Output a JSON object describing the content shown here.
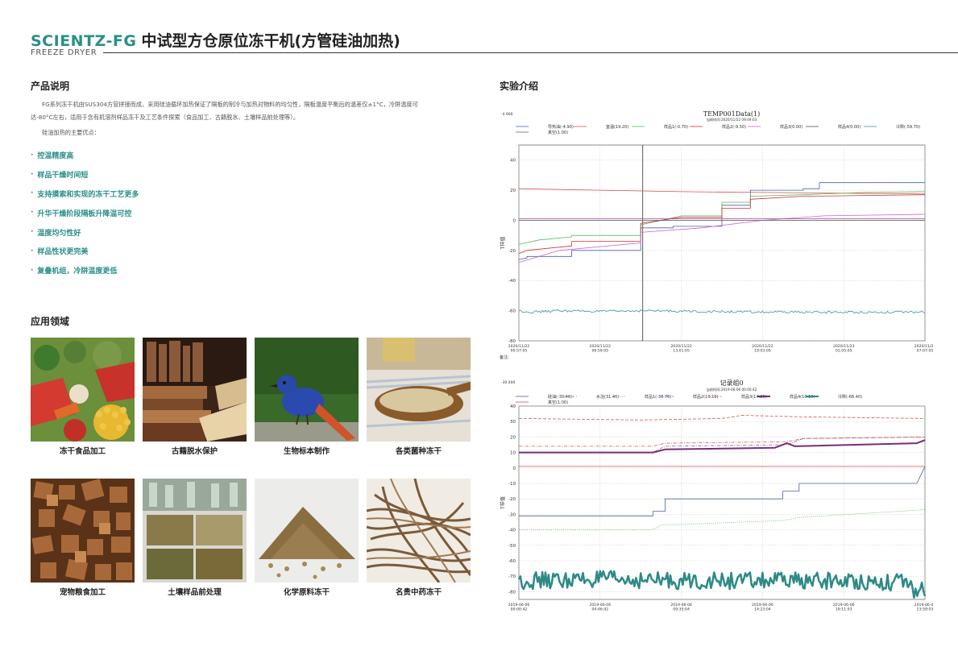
{
  "header": {
    "brand": "SCIENTZ-FG",
    "title": "中试型方仓原位冻干机(方管硅油加热)",
    "subtitle": "FREEZE DRYER"
  },
  "product": {
    "heading": "产品说明",
    "line1": "FG系列冻干机由SUS304方管拼接而成，采用硅油循环加热保证了隔板的制冷与加热对物料的均匀性，隔板温度平衡后的温差仅±1°C，冷阱温度可",
    "line2": "达-80°C左右，适用于含有机溶剂样品冻干及工艺条件探索（食品加工、古籍脱水、土壤样品前处理等）。",
    "advantages_intro": "硅油加热的主要优点：",
    "features": [
      "控温精度高",
      "样品干燥时间短",
      "支持摸索和实现的冻干工艺更多",
      "升华干燥阶段隔板升降温可控",
      "温度均匀性好",
      "样品性状更完美",
      "复叠机组，冷阱温度更低"
    ]
  },
  "applications": {
    "heading": "应用领域",
    "items": [
      "冻干食品加工",
      "古籍脱水保护",
      "生物标本制作",
      "各类菌种冻干",
      "宠物粮食加工",
      "土壤样品前处理",
      "化学原料冻干",
      "名贵中药冻干"
    ]
  },
  "experiment": {
    "heading": "实验介绍"
  },
  "chart_data": [
    {
      "type": "line",
      "title": "TEMP001Data(1)",
      "subtitle": "当前时间:2020/11/22  09:49:03",
      "corner_label": "-4.900",
      "ylabel": "T样值",
      "footer_label": "备注:",
      "ylim": [
        -80,
        50
      ],
      "yticks": [
        -80,
        -60,
        -40,
        -20,
        0,
        20,
        40
      ],
      "x_ticks": [
        "2020/11/22\n00:57:05",
        "2020/11/22\n06:59:05",
        "2020/11/22\n13:01:05",
        "2020/11/22\n19:03:05",
        "2020/11/23\n01:05:05",
        "2020/11/23\n07:07:05"
      ],
      "grid": true,
      "cursor_x": 0.305,
      "series": [
        {
          "name": "导热油(-4.90)",
          "color": "#4a5fb0",
          "style": "solid",
          "width": 0.8,
          "x": [
            0,
            0.02,
            0.02,
            0.13,
            0.13,
            0.3,
            0.3,
            0.38,
            0.38,
            0.5,
            0.5,
            0.57,
            0.57,
            0.7,
            0.7,
            0.74,
            0.74,
            1
          ],
          "y": [
            -26,
            -25,
            -24,
            -24,
            -20,
            -20,
            -5,
            -5,
            -4,
            -4,
            10,
            10,
            20,
            20,
            21,
            21,
            25,
            25
          ]
        },
        {
          "name": "室温(19.20)",
          "color": "#d9534f",
          "style": "solid",
          "width": 0.8,
          "x": [
            0,
            0.2,
            0.4,
            0.6,
            0.8,
            1
          ],
          "y": [
            21,
            20,
            19,
            18.5,
            18,
            17.5
          ]
        },
        {
          "name": "样品1(-0.70)",
          "color": "#5cb85c",
          "style": "solid",
          "width": 0.8,
          "x": [
            0,
            0.05,
            0.13,
            0.13,
            0.3,
            0.3,
            0.4,
            0.5,
            0.5,
            0.57,
            0.57,
            0.7,
            0.85,
            1
          ],
          "y": [
            -16,
            -13,
            -11,
            -10,
            -10,
            -3,
            3,
            3,
            12,
            12,
            16,
            17,
            18.5,
            19
          ]
        },
        {
          "name": "样品2(-9.50)",
          "color": "#cc3333",
          "style": "solid",
          "width": 0.8,
          "x": [
            0,
            0.02,
            0.13,
            0.13,
            0.3,
            0.3,
            0.4,
            0.5,
            0.5,
            0.57,
            0.57,
            0.7,
            1
          ],
          "y": [
            -22,
            -20,
            -17,
            -14,
            -14,
            -2,
            2,
            2,
            8,
            8,
            14,
            16,
            17
          ]
        },
        {
          "name": "样品3(0.00)",
          "color": "#cc66cc",
          "style": "solid",
          "width": 0.8,
          "x": [
            0,
            0.1,
            0.3,
            0.3,
            0.45,
            0.6,
            0.75,
            1
          ],
          "y": [
            -28,
            -20,
            -15,
            -8,
            -5,
            0,
            3,
            4
          ]
        },
        {
          "name": "样品4(0.00)",
          "color": "#555555",
          "style": "solid",
          "width": 0.8,
          "x": [
            0,
            1
          ],
          "y": [
            0,
            0
          ]
        },
        {
          "name": "冷阱(-59.70)",
          "color": "#3a9a9a",
          "style": "noisy",
          "width": 0.8,
          "x": [
            0,
            0.03,
            0.1,
            0.2,
            0.3,
            0.45,
            0.6,
            0.8,
            1
          ],
          "y": [
            -60,
            -61,
            -60,
            -60.5,
            -60,
            -60.5,
            -61,
            -61,
            -61
          ]
        },
        {
          "name": "真空(1.00)",
          "color": "#9a4a9a",
          "style": "solid",
          "width": 0.8,
          "x": [
            0,
            1
          ],
          "y": [
            1,
            1
          ]
        }
      ]
    },
    {
      "type": "line",
      "title": "记录组0",
      "subtitle": "当前时间:2019-06-06  00:00:42",
      "corner_label": "-30.400",
      "ylabel": "T样值",
      "ylim": [
        -85,
        40
      ],
      "yticks": [
        -80,
        -70,
        -60,
        -50,
        -40,
        -30,
        -20,
        -10,
        0,
        10,
        20,
        30,
        40
      ],
      "x_ticks": [
        "2019-06-06\n00:00:42",
        "2019-06-06\n04:46:42",
        "2019-06-06\n09:35:04",
        "2019-06-06\n14:23:04",
        "2019-06-06\n19:11:03",
        "2019-06-06\n23:59:03"
      ],
      "grid": true,
      "series": [
        {
          "name": "硅油(-30.40)",
          "color": "#4a5fb0",
          "style": "solid",
          "width": 0.8,
          "x": [
            0,
            0.33,
            0.33,
            0.36,
            0.36,
            0.65,
            0.65,
            0.69,
            0.69,
            0.98,
            1
          ],
          "y": [
            -31,
            -31,
            -28,
            -28,
            -20,
            -20,
            -15,
            -15,
            -10,
            -10,
            1
          ]
        },
        {
          "name": "水浴(31.40)",
          "color": "#d9534f",
          "style": "dash",
          "width": 0.8,
          "x": [
            0,
            0.3,
            0.5,
            0.55,
            0.7,
            1
          ],
          "y": [
            32,
            31,
            32,
            34,
            33,
            32
          ]
        },
        {
          "name": "样品1(-39.70)",
          "color": "#5cb85c",
          "style": "dot",
          "width": 0.8,
          "x": [
            0,
            0.33,
            0.35,
            0.65,
            0.69,
            1
          ],
          "y": [
            -40,
            -40,
            -37,
            -34,
            -32,
            -27
          ]
        },
        {
          "name": "样品2(10.10)",
          "color": "#7a5fb0",
          "style": "dashdot",
          "width": 0.8,
          "x": [
            0,
            0.33,
            0.36,
            0.66,
            0.7,
            1
          ],
          "y": [
            10,
            10,
            14,
            15,
            19,
            20
          ]
        },
        {
          "name": "样品3(14.20)",
          "color": "#d9534f",
          "style": "dashdot",
          "width": 0.8,
          "x": [
            0,
            0.33,
            0.36,
            0.66,
            0.7,
            1
          ],
          "y": [
            14,
            14,
            16,
            17,
            19,
            20
          ]
        },
        {
          "name": "样品4(10.10)",
          "color": "#7b2a7b",
          "style": "solid",
          "width": 2,
          "x": [
            0,
            0.33,
            0.36,
            0.63,
            0.66,
            0.68,
            0.98,
            1
          ],
          "y": [
            10,
            10,
            12,
            13,
            16,
            14,
            16,
            18
          ]
        },
        {
          "name": "冷阱(-68.40)",
          "color": "#2e8a86",
          "style": "noisy-thick",
          "width": 2.5,
          "x": [
            0,
            0.2,
            0.4,
            0.6,
            0.8,
            0.95,
            0.98,
            1
          ],
          "y": [
            -73,
            -72,
            -73,
            -73,
            -73,
            -74,
            -81,
            -78
          ]
        },
        {
          "name": "真空(1.00)",
          "color": "#d9534f",
          "style": "solid",
          "width": 0.8,
          "x": [
            0,
            1
          ],
          "y": [
            1,
            1
          ]
        }
      ]
    }
  ]
}
